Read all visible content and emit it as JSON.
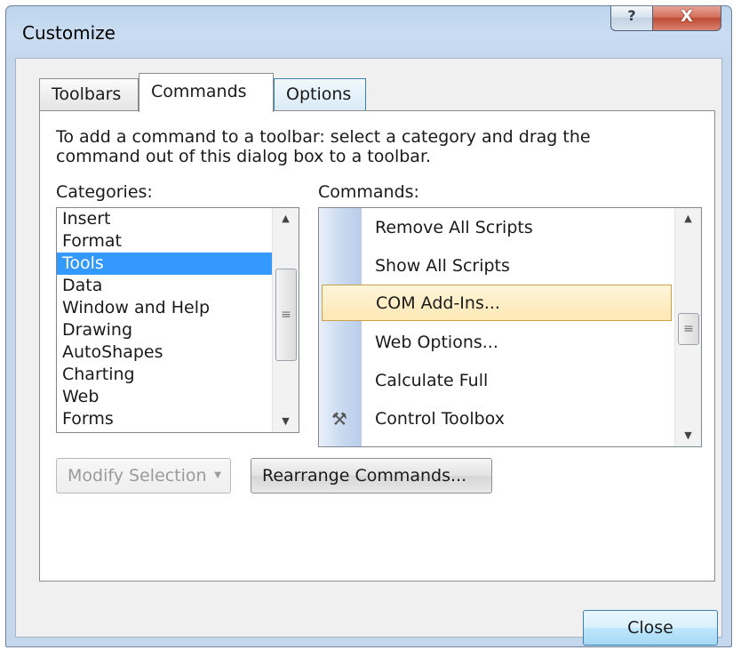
{
  "window": {
    "title": "Customize",
    "help_glyph": "?",
    "close_glyph": "X"
  },
  "tabs": [
    {
      "label": "Toolbars"
    },
    {
      "label": "Commands"
    },
    {
      "label": "Options"
    }
  ],
  "instructions": "To add a command to a toolbar: select a category and drag the command out of this dialog box to a toolbar.",
  "categories": {
    "label": "Categories:",
    "items": [
      "Insert",
      "Format",
      "Tools",
      "Data",
      "Window and Help",
      "Drawing",
      "AutoShapes",
      "Charting",
      "Web",
      "Forms"
    ],
    "selected": "Tools"
  },
  "commands": {
    "label": "Commands:",
    "items": [
      {
        "label": "Remove All Scripts",
        "icon": ""
      },
      {
        "label": "Show All Scripts",
        "icon": ""
      },
      {
        "label": "COM Add-Ins...",
        "icon": ""
      },
      {
        "label": "Web Options...",
        "icon": ""
      },
      {
        "label": "Calculate Full",
        "icon": ""
      },
      {
        "label": "Control Toolbox",
        "icon": "tools-icon"
      }
    ],
    "highlighted": "COM Add-Ins..."
  },
  "buttons": {
    "modify_selection": "Modify Selection",
    "rearrange_commands": "Rearrange Commands...",
    "close": "Close"
  },
  "colors": {
    "selection": "#3399ff",
    "highlight": "#fde8b5",
    "accent": "#3c7fb1"
  }
}
